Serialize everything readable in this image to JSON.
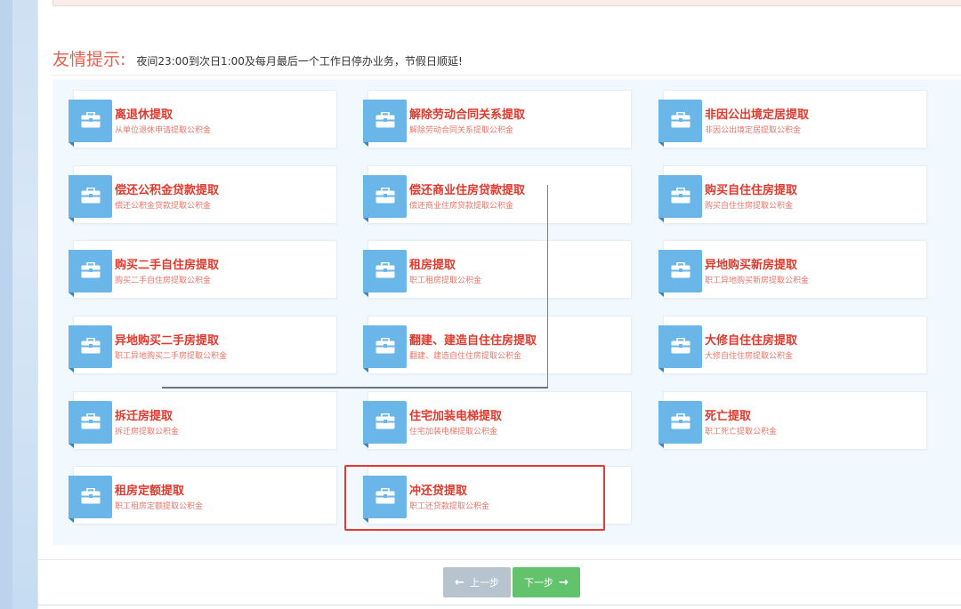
{
  "tip": {
    "label": "友情提示:",
    "text": "夜间23:00到次日1:00及每月最后一个工作日停办业务，节假日顺延!"
  },
  "cards": [
    {
      "title": "离退休提取",
      "sub": "从单位退休申请提取公积金",
      "icon": "briefcase-icon"
    },
    {
      "title": "解除劳动合同关系提取",
      "sub": "解除劳动合同关系提取公积金",
      "icon": "briefcase-icon"
    },
    {
      "title": "非因公出境定居提取",
      "sub": "非因公出境定居提取公积金",
      "icon": "briefcase-icon"
    },
    {
      "title": "偿还公积金贷款提取",
      "sub": "偿还公积金贷款提取公积金",
      "icon": "briefcase-icon"
    },
    {
      "title": "偿还商业住房贷款提取",
      "sub": "偿还商业住房贷款提取公积金",
      "icon": "briefcase-icon"
    },
    {
      "title": "购买自住住房提取",
      "sub": "购买自住住房提取公积金",
      "icon": "briefcase-icon"
    },
    {
      "title": "购买二手自住房提取",
      "sub": "购买二手自住房提取公积金",
      "icon": "briefcase-icon"
    },
    {
      "title": "租房提取",
      "sub": "职工租房提取公积金",
      "icon": "briefcase-icon"
    },
    {
      "title": "异地购买新房提取",
      "sub": "职工异地购买新房提取公积金",
      "icon": "briefcase-icon"
    },
    {
      "title": "异地购买二手房提取",
      "sub": "职工异地购买二手房提取公积金",
      "icon": "briefcase-icon"
    },
    {
      "title": "翻建、建造自住住房提取",
      "sub": "翻建、建造自住住房提取公积金",
      "icon": "briefcase-icon"
    },
    {
      "title": "大修自住住房提取",
      "sub": "大修自住住房提取公积金",
      "icon": "briefcase-icon"
    },
    {
      "title": "拆迁房提取",
      "sub": "拆迁房提取公积金",
      "icon": "briefcase-icon"
    },
    {
      "title": "住宅加装电梯提取",
      "sub": "住宅加装电梯提取公积金",
      "icon": "briefcase-icon"
    },
    {
      "title": "死亡提取",
      "sub": "职工死亡提取公积金",
      "icon": "briefcase-icon"
    },
    {
      "title": "租房定额提取",
      "sub": "职工租房定额提取公积金",
      "icon": "briefcase-icon"
    },
    {
      "title": "冲还贷提取",
      "sub": "职工还贷款提取公积金",
      "icon": "briefcase-icon"
    }
  ],
  "selected_card_index": 16,
  "buttons": {
    "prev_label": "上一步",
    "next_label": "下一步"
  },
  "colors": {
    "title_red": "#e03a2e",
    "badge_blue": "#6ab6e8",
    "next_green": "#62c36c",
    "prev_gray": "#b7c4cf",
    "highlight_red": "#e53935"
  }
}
